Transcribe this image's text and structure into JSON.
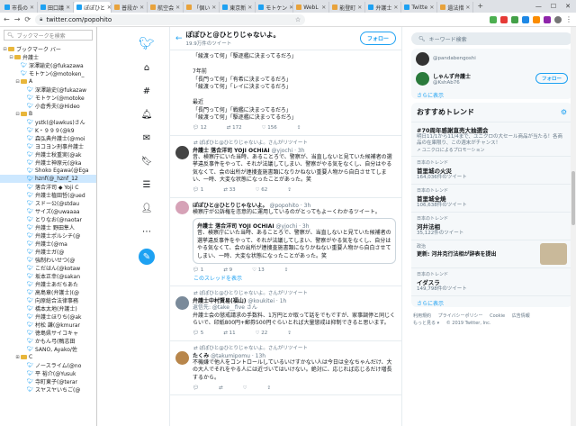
{
  "browser": {
    "tabs": [
      {
        "label": "市長の",
        "color": "#1da1f2",
        "active": false
      },
      {
        "label": "田口議",
        "color": "#1da1f2",
        "active": false
      },
      {
        "label": "ぽぽひと",
        "color": "#1da1f2",
        "active": true
      },
      {
        "label": "普段か",
        "color": "#e8a23b",
        "active": false
      },
      {
        "label": "航空会",
        "color": "#e8a23b",
        "active": false
      },
      {
        "label": "「個い",
        "color": "#e8a23b",
        "active": false
      },
      {
        "label": "東京新",
        "color": "#1da1f2",
        "active": false
      },
      {
        "label": "モトケン",
        "color": "#1da1f2",
        "active": false
      },
      {
        "label": "WebL",
        "color": "#e8a23b",
        "active": false
      },
      {
        "label": "能登町",
        "color": "#e8a23b",
        "active": false
      },
      {
        "label": "弁護士",
        "color": "#1da1f2",
        "active": false
      },
      {
        "label": "Twitte",
        "color": "#1da1f2",
        "active": false
      },
      {
        "label": "遺法措",
        "color": "#e8a23b",
        "active": false
      }
    ],
    "url": "twitter.com/popohito",
    "window_min": "—",
    "window_max": "☐",
    "window_close": "✕"
  },
  "bookmarks": {
    "search_placeholder": "ブックマークを検索",
    "items": [
      {
        "indent": 0,
        "type": "folder",
        "toggle": "⊟",
        "label": "ブックマーク バー"
      },
      {
        "indent": 1,
        "type": "folder",
        "toggle": "⊟",
        "label": "弁護士"
      },
      {
        "indent": 2,
        "type": "bird",
        "label": "深澤諭史(@fukazawa"
      },
      {
        "indent": 2,
        "type": "bird",
        "label": "モトケン(@motoken_"
      },
      {
        "indent": 2,
        "type": "folder",
        "toggle": "⊟",
        "label": "A"
      },
      {
        "indent": 3,
        "type": "bird",
        "label": "深澤諭史(@fukazaw"
      },
      {
        "indent": 3,
        "type": "bird",
        "label": "モトケン(@motoke"
      },
      {
        "indent": 3,
        "type": "bird",
        "label": "小倉秀夫(@Hideo"
      },
      {
        "indent": 2,
        "type": "folder",
        "toggle": "⊟",
        "label": "B"
      },
      {
        "indent": 3,
        "type": "bird",
        "label": "ystk(@lawkus)さん"
      },
      {
        "indent": 3,
        "type": "bird",
        "label": "K・９９９(@k9"
      },
      {
        "indent": 3,
        "type": "bird",
        "label": "森弘典弁護士(@moi"
      },
      {
        "indent": 3,
        "type": "bird",
        "label": "ヨコヨン刑事弁護士"
      },
      {
        "indent": 3,
        "type": "bird",
        "label": "弁護士秋重実(@ak"
      },
      {
        "indent": 3,
        "type": "bird",
        "label": "弁護士神原元(@ka"
      },
      {
        "indent": 3,
        "type": "bird",
        "label": "Shoko Egawa(@Ega"
      },
      {
        "indent": 3,
        "type": "bird",
        "label": "hznf(@_hznf_12",
        "selected": true
      },
      {
        "indent": 3,
        "type": "bird",
        "label": "落合洋司 ◆ Yoji C"
      },
      {
        "indent": 3,
        "type": "bird",
        "label": "弁護士植田哲(@ued"
      },
      {
        "indent": 3,
        "type": "bird",
        "label": "スドー公(@stdau"
      },
      {
        "indent": 3,
        "type": "bird",
        "label": "サイズ(@uwaaaa"
      },
      {
        "indent": 3,
        "type": "bird",
        "label": "とりなお(@naotar"
      },
      {
        "indent": 3,
        "type": "bird",
        "label": "弁護士 野田隼人"
      },
      {
        "indent": 3,
        "type": "bird",
        "label": "弁護士ポルシチ(@"
      },
      {
        "indent": 3,
        "type": "bird",
        "label": "弁護士(@ma"
      },
      {
        "indent": 3,
        "type": "bird",
        "label": "弁護士ガ(@"
      },
      {
        "indent": 3,
        "type": "bird",
        "label": "強制わいせつ(@"
      },
      {
        "indent": 3,
        "type": "bird",
        "label": "こだはん(@kotaw"
      },
      {
        "indent": 3,
        "type": "bird",
        "label": "坂本正幸(@sakan"
      },
      {
        "indent": 3,
        "type": "bird",
        "label": "弁護士あだちあた"
      },
      {
        "indent": 3,
        "type": "bird",
        "label": "高島章(弁護士)(@"
      },
      {
        "indent": 3,
        "type": "bird",
        "label": "向原総合法律事務"
      },
      {
        "indent": 3,
        "type": "bird",
        "label": "橋本太地(弁護士)"
      },
      {
        "indent": 3,
        "type": "bird",
        "label": "弁護士ほりち(@ak"
      },
      {
        "indent": 3,
        "type": "bird",
        "label": "村松 謙(@kmurar"
      },
      {
        "indent": 3,
        "type": "bird",
        "label": "徳島県サイコキャ"
      },
      {
        "indent": 3,
        "type": "bird",
        "label": "かもん弓(鴨志田"
      },
      {
        "indent": 3,
        "type": "bird",
        "label": "SANO, Ayako/佐"
      },
      {
        "indent": 2,
        "type": "folder",
        "toggle": "⊞",
        "label": "C"
      },
      {
        "indent": 3,
        "type": "bird",
        "label": "ノースライム(@no"
      },
      {
        "indent": 3,
        "type": "bird",
        "label": "平 裕介(@Yusuk"
      },
      {
        "indent": 3,
        "type": "bird",
        "label": "寺町東子(@terar"
      },
      {
        "indent": 3,
        "type": "bird",
        "label": "スヤスヤいちご(@"
      }
    ]
  },
  "rail": {
    "icons": [
      "twitter-bird",
      "hashtag-home",
      "explore",
      "notifications",
      "messages",
      "bookmarks",
      "lists",
      "profile",
      "more",
      "compose"
    ]
  },
  "profile_header": {
    "back": "←",
    "name": "ぽぽひと@ひとりじゃないよ。",
    "count": "19.9万件のツイート",
    "follow_label": "フォロー"
  },
  "tweets": [
    {
      "kind": "continuation",
      "avatar": "",
      "name": "",
      "handle": "",
      "text": "「綾渡って何」「駆逐艦に決まってるだろ」\n\n7年前\n「長門って何」「有希に決まってるだろ」\n「綾渡って何」「レイに決まってるだろ」\n\n最近\n「長門って何」「戦艦に決まってるだろ」\n「綾渡って何」「駆逐艦に決まってるだろ」",
      "replies": "12",
      "rts": "172",
      "likes": "156"
    },
    {
      "kind": "rt",
      "rt_label": "ぽぽひと@ひとりじゃないよ。さんがリツイート",
      "avatar_color": "#444",
      "name": "弁護士 落合洋司 YOJI OCHIAI",
      "handle": "@yjochi · 3h",
      "text": "昔、検察庁にいた当時、あることろで、警察が、当直しないと見ていた候補者の選挙違反事件をやって、それが法議してしまい、警察がやる気をなくし、自分はやる気なくて、会の出所が連捜査施書類になりかねない重要人物から自白させてしまい、一時、大変な状態になったことがあった。笑",
      "replies": "1",
      "rts": "33",
      "likes": "62"
    },
    {
      "kind": "quote",
      "rt_label": "",
      "avatar_color": "#d6a2b7",
      "name": "ぽぽひと@ひとりじゃないよ。",
      "handle": "@popohito · 3h",
      "text": "検察庁が公訴権を恣意的に運用しているのがとってもよーくわかるツイート。",
      "quote_name": "弁護士 落合洋司 YOJI OCHIAI",
      "quote_handle": "@yjochi · 3h",
      "quote_text": "昔、検察庁にいた当時、あることろで、警察が、当直しないと見ていた候補者の選挙違反事件をやって、それが法議してしまい、警察がやる気をなくし、自分はやる気なくて、会の出所が連捜査施書類になりかねない重要人物から自白させてしまい、一時、大変な状態になったことがあった。笑",
      "replies": "1",
      "rts": "9",
      "likes": "13",
      "thread_link": "このスレッドを表示"
    },
    {
      "kind": "rt",
      "rt_label": "ぽぽひと@ひとりじゃないよ。さんがリツイート",
      "avatar_color": "#7a8a9a",
      "name": "弁護士中村賢易(福山)",
      "handle": "@koukitei · 1h",
      "reply_to": "返信先: @take__five さん",
      "text": "弁護士会の懲戒請求の手数料、1万円とか取って話をでもですが、家事調停と同じくらいで、印紙800円+郵券500円ぐらいとれば大量懲戒は抑制できると思います。",
      "replies": "5",
      "rts": "11",
      "likes": "22"
    },
    {
      "kind": "rt",
      "rt_label": "ぽぽひと@ひとりじゃないよ。さんがリツイート",
      "avatar_color": "#b8864b",
      "name": "たくみ",
      "handle": "@takumipomu · 13h",
      "text": "不機嫌で他人をコントロールしているいけすかない人は今日は全なちゃんだけ、大の大人でそれをやる人には近づいてはいけない。絶対に、応じれば応じるだけ増長するから。",
      "replies": "",
      "rts": "",
      "likes": ""
    }
  ],
  "sidebar": {
    "search_placeholder": "キーワード検索",
    "follow_suggest": [
      {
        "name": "",
        "handle": "@pandabengoshi",
        "avatar_color": "#333"
      },
      {
        "name": "しゃんず弁護士",
        "handle": "@KshAb76",
        "avatar_color": "#2a7a3b",
        "follow_label": "フォロー"
      }
    ],
    "more_label": "さらに表示",
    "trends_title": "おすすめトレンド",
    "trends": [
      {
        "category": "",
        "title": "#70周年感謝直売大抽選会",
        "desc": "明日11/1から11/4まで、ユニクロの大セール商品が当たる！各商品の在庫限り、この週末がチャンス！",
        "promo": "ユニクロによるプロモーション"
      },
      {
        "category": "日本のトレンド",
        "title": "首里城の火災",
        "desc": "164,036件のツイート"
      },
      {
        "category": "日本のトレンド",
        "title": "首里城全焼",
        "desc": "106,638件のツイート"
      },
      {
        "category": "日本のトレンド",
        "title": "河井法相",
        "desc": "35,122件のツイート"
      }
    ],
    "news": {
      "category": "政治",
      "title": "更新: 河井克行法相が辞表を提出"
    },
    "trend_last": {
      "category": "日本のトレンド",
      "title": "イダスラ",
      "desc": "149,798件のツイート"
    },
    "more_label2": "さらに表示",
    "footer": [
      "利用規約",
      "プライバシーポリシー",
      "Cookie",
      "広告情報",
      "もっと見る ▾",
      "© 2019 Twitter, Inc."
    ]
  }
}
